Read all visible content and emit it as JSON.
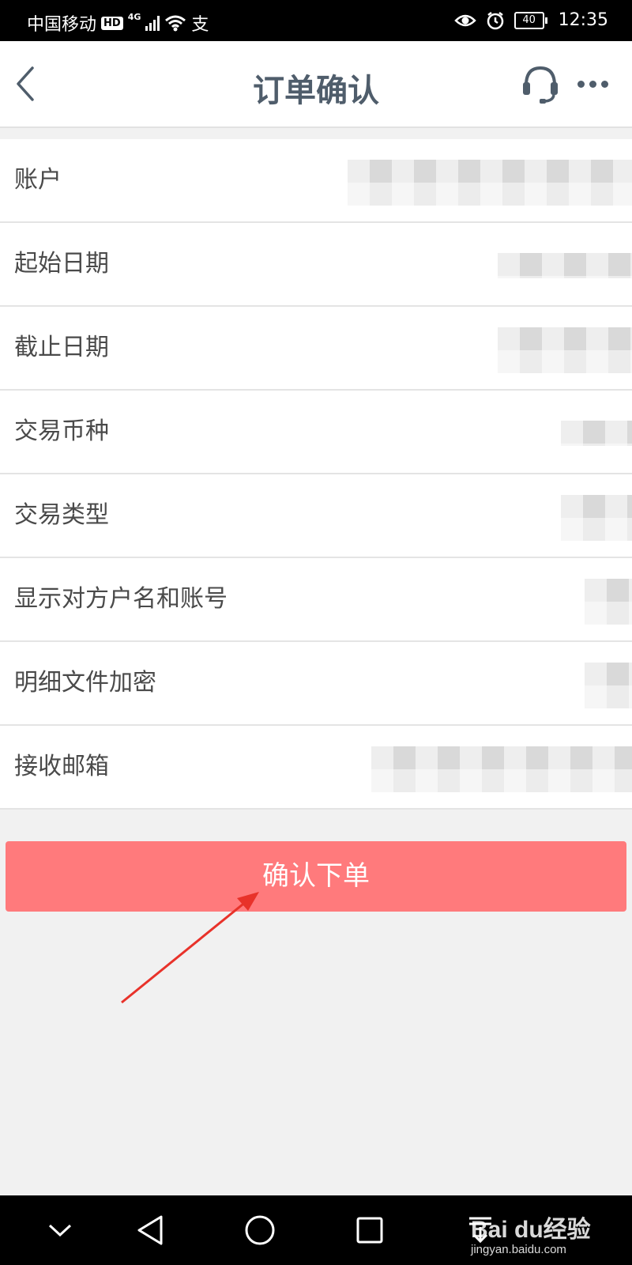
{
  "status_bar": {
    "carrier": "中国移动",
    "hd_badge": "HD",
    "network": "4G",
    "alipay_glyph": "支",
    "battery_level": "40",
    "time": "12:35"
  },
  "header": {
    "title": "订单确认",
    "back_icon": "chevron-left-icon",
    "support_icon": "headset-icon",
    "more_icon": "more-horizontal-icon"
  },
  "form": {
    "rows": [
      {
        "label": "账户"
      },
      {
        "label": "起始日期"
      },
      {
        "label": "截止日期"
      },
      {
        "label": "交易币种"
      },
      {
        "label": "交易类型"
      },
      {
        "label": "显示对方户名和账号"
      },
      {
        "label": "明细文件加密"
      },
      {
        "label": "接收邮箱"
      }
    ]
  },
  "confirm_button": {
    "label": "确认下单",
    "color": "#ff7a7c"
  },
  "annotation": {
    "color": "#e8322a"
  },
  "watermark": {
    "main": "Bai du经验",
    "sub": "jingyan.baidu.com"
  },
  "colors": {
    "title": "#4f5d6b",
    "background": "#f1f1f1"
  }
}
